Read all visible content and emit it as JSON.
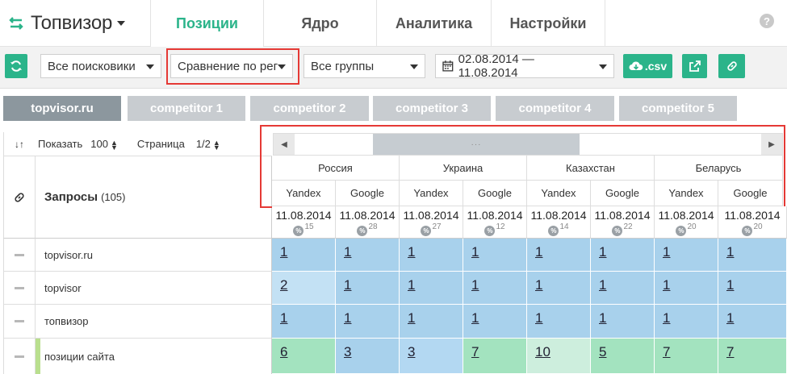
{
  "app": {
    "brand": "Топвизор",
    "tabs": [
      "Позиции",
      "Ядро",
      "Аналитика",
      "Настройки"
    ],
    "active_tab": "Позиции",
    "help": "?"
  },
  "toolbar": {
    "search_engines": "Все поисковики",
    "mode": "Сравнение по рег",
    "groups": "Все группы",
    "date_range": "02.08.2014 — 11.08.2014",
    "csv_label": ".csv"
  },
  "projects": [
    "topvisor.ru",
    "competitor 1",
    "competitor 2",
    "competitor 3",
    "competitor 4",
    "competitor 5"
  ],
  "table": {
    "show_label": "Показать",
    "show_count": "100",
    "page_label": "Страница",
    "page_value": "1/2",
    "queries_label": "Запросы",
    "queries_count": "(105)",
    "scroll_dots": "···",
    "regions": [
      "Россия",
      "Украина",
      "Казахстан",
      "Беларусь"
    ],
    "engines": [
      "Yandex",
      "Google",
      "Yandex",
      "Google",
      "Yandex",
      "Google",
      "Yandex",
      "Google"
    ],
    "dates": [
      {
        "date": "11.08.2014",
        "pct": "15"
      },
      {
        "date": "11.08.2014",
        "pct": "28"
      },
      {
        "date": "11.08.2014",
        "pct": "27"
      },
      {
        "date": "11.08.2014",
        "pct": "12"
      },
      {
        "date": "11.08.2014",
        "pct": "14"
      },
      {
        "date": "11.08.2014",
        "pct": "22"
      },
      {
        "date": "11.08.2014",
        "pct": "20"
      },
      {
        "date": "11.08.2014",
        "pct": "20"
      }
    ],
    "rows": [
      {
        "query": "topvisor.ru",
        "positions": [
          "1",
          "1",
          "1",
          "1",
          "1",
          "1",
          "1",
          "1"
        ]
      },
      {
        "query": "topvisor",
        "positions": [
          "2",
          "1",
          "1",
          "1",
          "1",
          "1",
          "1",
          "1"
        ]
      },
      {
        "query": "топвизор",
        "positions": [
          "1",
          "1",
          "1",
          "1",
          "1",
          "1",
          "1",
          "1"
        ]
      },
      {
        "query": "позиции сайта",
        "positions": [
          "6",
          "3",
          "3",
          "7",
          "10",
          "5",
          "7",
          "7"
        ]
      }
    ]
  },
  "colors": {
    "accent": "#2bb48a",
    "top1": "#a8d1ec",
    "top3": "#b7dbf1",
    "top10_dark": "#a3e3bf",
    "top10_light": "#cdeedd",
    "top3_alt": "#b3d8f2",
    "highlight": "#e53935"
  }
}
